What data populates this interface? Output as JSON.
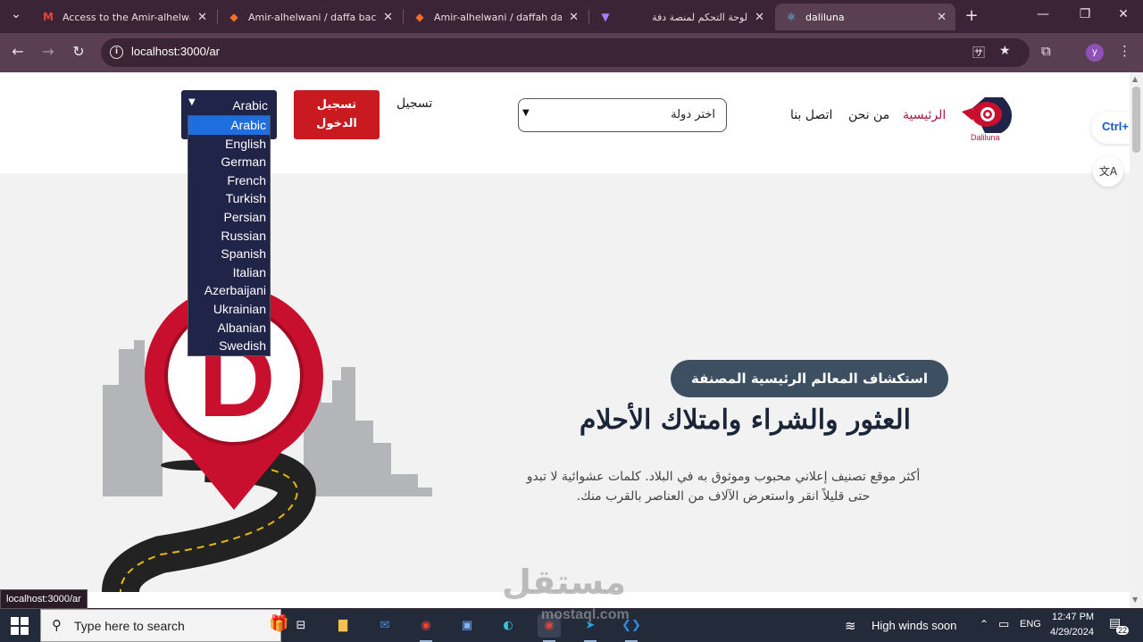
{
  "browser": {
    "tabs": [
      {
        "title": "Access to the Amir-alhelwani",
        "icon": "gmail-icon"
      },
      {
        "title": "Amir-alhelwani / daffa backe",
        "icon": "gitlab-icon"
      },
      {
        "title": "Amir-alhelwani / daffah dash",
        "icon": "gitlab-icon"
      },
      {
        "title": "",
        "icon": "vite-icon"
      },
      {
        "title": "لوحة التحكم لمنصة دفة",
        "icon": ""
      },
      {
        "title": "daliluna",
        "icon": "react-icon"
      }
    ],
    "url": "localhost:3000/ar",
    "profile_initial": "y",
    "status_url": "localhost:3000/ar"
  },
  "site": {
    "logo_text": "Daliluna",
    "nav": {
      "home": "الرئيسية",
      "about": "من نحن",
      "contact": "اتصل بنا"
    },
    "country_select": {
      "value": "اختر دولة"
    },
    "register": "تسجيل",
    "login": "تسجيل الدخول",
    "language": {
      "selected": "Arabic",
      "options": [
        "Arabic",
        "English",
        "German",
        "French",
        "Turkish",
        "Persian",
        "Russian",
        "Spanish",
        "Italian",
        "Azerbaijani",
        "Ukrainian",
        "Albanian",
        "Swedish"
      ]
    },
    "ext_chip": "Ctrl+",
    "hero": {
      "badge": "استكشاف المعالم الرئيسية المصنفة",
      "title": "العثور والشراء وامتلاك الأحلام",
      "description_line1": "أكثر موقع تصنيف إعلاني محبوب وموثوق به في البلاد. كلمات عشوائية لا تبدو",
      "description_line2": "حتى قليلاً انقر واستعرض الآلاف من العناصر بالقرب منك."
    }
  },
  "watermark": {
    "arabic": "مستقل",
    "latin": "mostaql.com"
  },
  "taskbar": {
    "search_placeholder": "Type here to search",
    "weather": "High winds soon",
    "language": "ENG",
    "time": "12:47 PM",
    "date": "4/29/2024",
    "notifications": "22"
  }
}
